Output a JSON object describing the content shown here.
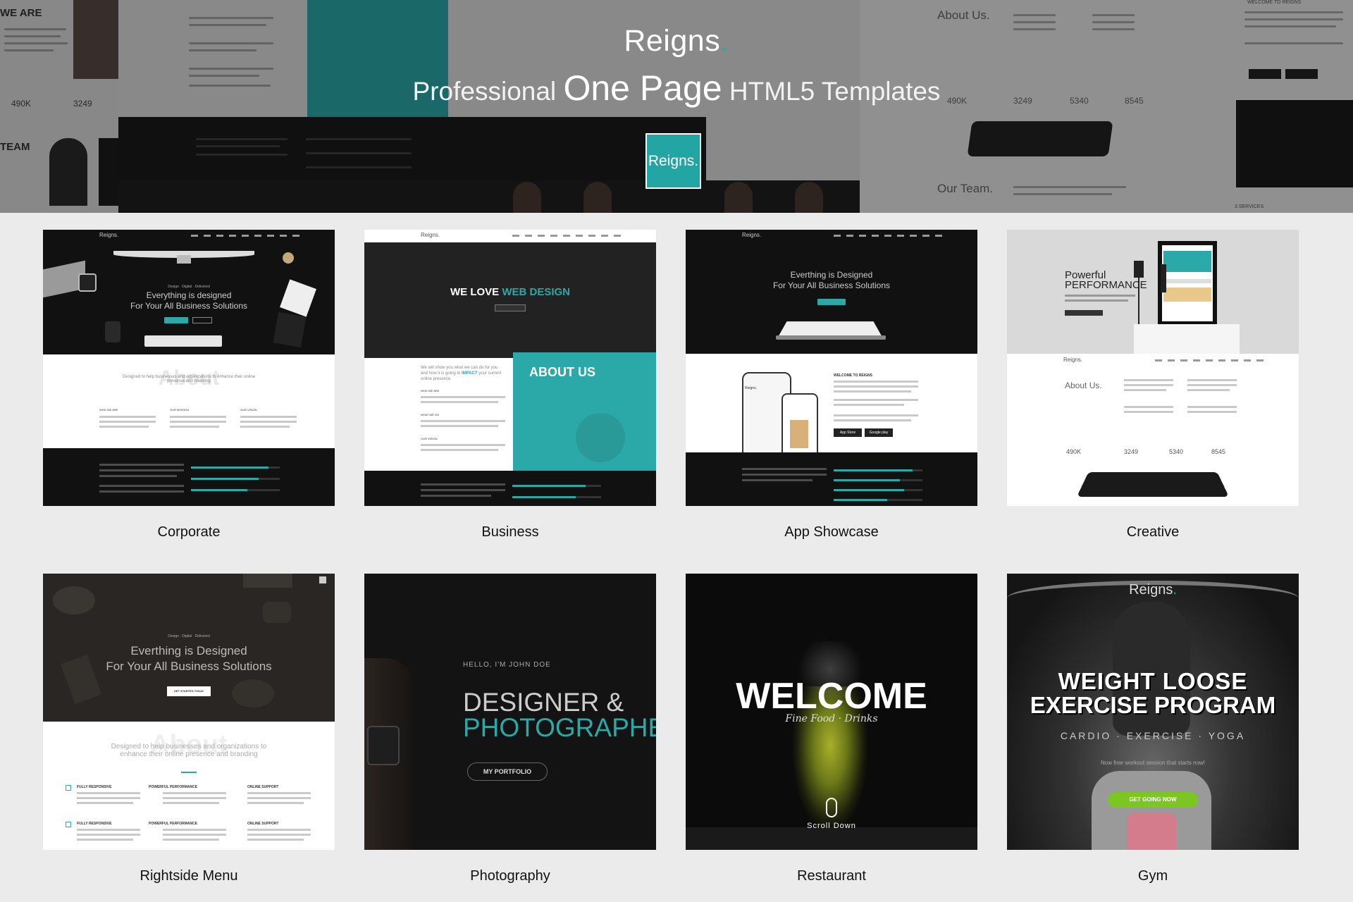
{
  "hero": {
    "logo_text": "Reigns",
    "logo_dot": ".",
    "tagline_pre": "Professional",
    "tagline_big": "One Page",
    "tagline_post": "HTML5 Templates",
    "badge_text": "Reigns.",
    "background": {
      "we_are": "WE ARE",
      "team": "TEAM",
      "about_us": "About Us.",
      "our_team": "Our Team.",
      "stat_1": "490K",
      "stat_2": "3249",
      "stat_3": "5340",
      "stat_4": "8545",
      "left_stat_1": "490K",
      "left_stat_2": "3249",
      "welcome": "WELCOME TO REIGNS",
      "services": "3 SERVICES"
    }
  },
  "templates": [
    {
      "name": "Corporate",
      "logo": "Reigns.",
      "tagline": "Design · Digital · Delivered",
      "headline_1": "Everything is designed",
      "headline_2": "For Your All Business Solutions",
      "section": "About",
      "section_sub": "Designed to help businesses and organizations to enhance their online presence and branding",
      "col_1": "WHO WE ARE",
      "col_2": "OUR MISSION",
      "col_3": "OUR VISION"
    },
    {
      "name": "Business",
      "logo": "Reigns.",
      "headline_pre": "WE LOVE",
      "headline_accent": "WEB DESIGN",
      "about": "ABOUT US",
      "intro_pre": "We will show you what we can do for you and how it is going to",
      "intro_accent": "IMPACT",
      "intro_post": "your current online presence",
      "col_1": "WHO WE ARE",
      "col_2": "WHAT WE DO",
      "col_3": "OUR VISION"
    },
    {
      "name": "App Showcase",
      "logo": "Reigns.",
      "headline_1": "Everthing is Designed",
      "headline_2": "For Your All Business Solutions",
      "welcome": "WELCOME TO REIGNS",
      "app_store": "App Store",
      "google_play": "Google play",
      "phone_logo": "Reigns."
    },
    {
      "name": "Creative",
      "logo": "Reigns.",
      "headline_1": "Powerful",
      "headline_2": "PERFORMANCE",
      "about": "About Us.",
      "stats": [
        "490K",
        "3249",
        "5340",
        "8545"
      ]
    },
    {
      "name": "Rightside Menu",
      "tagline": "Design · Digital · Delivered",
      "headline_1": "Everthing is Designed",
      "headline_2": "For Your All Business Solutions",
      "cta": "GET STARTED TODAY",
      "section": "About",
      "section_sub": "Designed to help businesses and organizations to enhance their online presence and branding",
      "features": [
        "FULLY RESPONSIVE",
        "POWERFUL PERFORMANCE",
        "ONLINE SUPPORT",
        "FULLY RESPONSIVE",
        "POWERFUL PERFORMANCE",
        "ONLINE SUPPORT"
      ]
    },
    {
      "name": "Photography",
      "intro": "HELLO, I'M JOHN DOE",
      "headline_1": "DESIGNER &",
      "headline_2": "PHOTOGRAPHER",
      "cta": "MY PORTFOLIO"
    },
    {
      "name": "Restaurant",
      "headline": "WELCOME",
      "sub": "Fine Food · Drinks",
      "scroll": "Scroll Down"
    },
    {
      "name": "Gym",
      "logo": "Reigns",
      "logo_dot": ".",
      "headline_1": "WEIGHT LOOSE",
      "headline_2": "EXERCISE PROGRAM",
      "sub": "CARDIO · EXERCISE · YOGA",
      "small": "Now free workout session that starts now!",
      "cta": "GET GOING NOW"
    }
  ]
}
